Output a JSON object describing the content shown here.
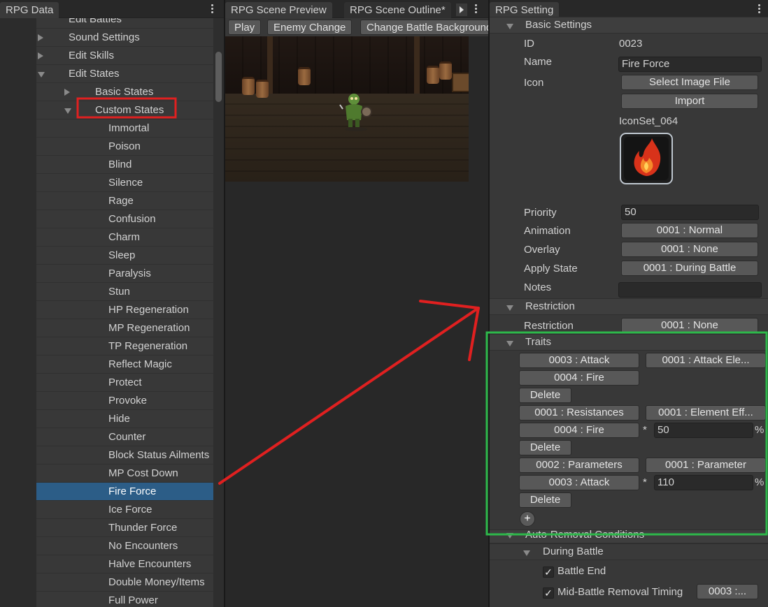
{
  "left_panel": {
    "tab": "RPG Data",
    "tree": [
      {
        "label": "Edit Battles",
        "level": 1,
        "arrow": "none",
        "partial": true
      },
      {
        "label": "Sound Settings",
        "level": 1,
        "arrow": "right"
      },
      {
        "label": "Edit Skills",
        "level": 1,
        "arrow": "right"
      },
      {
        "label": "Edit States",
        "level": 1,
        "arrow": "down"
      },
      {
        "label": "Basic States",
        "level": 2,
        "arrow": "right"
      },
      {
        "label": "Custom States",
        "level": 2,
        "arrow": "down"
      },
      {
        "label": "Immortal",
        "level": 3
      },
      {
        "label": "Poison",
        "level": 3
      },
      {
        "label": "Blind",
        "level": 3
      },
      {
        "label": "Silence",
        "level": 3
      },
      {
        "label": "Rage",
        "level": 3
      },
      {
        "label": "Confusion",
        "level": 3
      },
      {
        "label": "Charm",
        "level": 3
      },
      {
        "label": "Sleep",
        "level": 3
      },
      {
        "label": "Paralysis",
        "level": 3
      },
      {
        "label": "Stun",
        "level": 3
      },
      {
        "label": "HP Regeneration",
        "level": 3
      },
      {
        "label": "MP Regeneration",
        "level": 3
      },
      {
        "label": "TP Regeneration",
        "level": 3
      },
      {
        "label": "Reflect Magic",
        "level": 3
      },
      {
        "label": "Protect",
        "level": 3
      },
      {
        "label": "Provoke",
        "level": 3
      },
      {
        "label": "Hide",
        "level": 3
      },
      {
        "label": "Counter",
        "level": 3
      },
      {
        "label": "Block Status Ailments",
        "level": 3
      },
      {
        "label": "MP Cost Down",
        "level": 3
      },
      {
        "label": "Fire Force",
        "level": 3,
        "selected": true
      },
      {
        "label": "Ice Force",
        "level": 3
      },
      {
        "label": "Thunder Force",
        "level": 3
      },
      {
        "label": "No Encounters",
        "level": 3
      },
      {
        "label": "Halve Encounters",
        "level": 3
      },
      {
        "label": "Double Money/Items",
        "level": 3
      },
      {
        "label": "Full Power",
        "level": 3
      }
    ]
  },
  "center_panel": {
    "tabs": [
      "RPG Scene Preview",
      "RPG Scene Outline*"
    ],
    "toolbar": {
      "play": "Play",
      "enemy_change": "Enemy Change",
      "change_background": "Change Battle Background"
    }
  },
  "right_panel": {
    "tab": "RPG Setting",
    "basic": {
      "header": "Basic Settings",
      "id_label": "ID",
      "id_value": "0023",
      "name_label": "Name",
      "name_value": "Fire Force",
      "icon_label": "Icon",
      "select_image": "Select Image File",
      "import": "Import",
      "icon_name": "IconSet_064",
      "priority_label": "Priority",
      "priority_value": "50",
      "animation_label": "Animation",
      "animation_value": "0001 : Normal",
      "overlay_label": "Overlay",
      "overlay_value": "0001 : None",
      "apply_state_label": "Apply State",
      "apply_state_value": "0001 : During Battle",
      "notes_label": "Notes",
      "notes_value": ""
    },
    "restriction": {
      "header": "Restriction",
      "label": "Restriction",
      "value": "0001 : None"
    },
    "traits": {
      "header": "Traits",
      "delete": "Delete",
      "add": "+",
      "items": [
        {
          "category": "0003 : Attack",
          "type": "0001 : Attack Ele...",
          "value_select": "0004 : Fire"
        },
        {
          "category": "0001 : Resistances",
          "type": "0001 : Element Eff...",
          "value_select": "0004 : Fire",
          "mult": "*",
          "amount": "50",
          "unit": "%"
        },
        {
          "category": "0002 : Parameters",
          "type": "0001 : Parameter",
          "value_select": "0003 : Attack",
          "mult": "*",
          "amount": "110",
          "unit": "%"
        }
      ]
    },
    "removal": {
      "header": "Auto-Removal Conditions",
      "during_battle": "During Battle",
      "battle_end": "Battle End",
      "battle_end_checked": true,
      "mid_battle": "Mid-Battle Removal Timing",
      "mid_battle_checked": true,
      "mid_battle_value": "0003 :..."
    }
  },
  "colors": {
    "annotation_red": "#e02020",
    "annotation_green": "#2db84a",
    "selection": "#2c5d87"
  }
}
